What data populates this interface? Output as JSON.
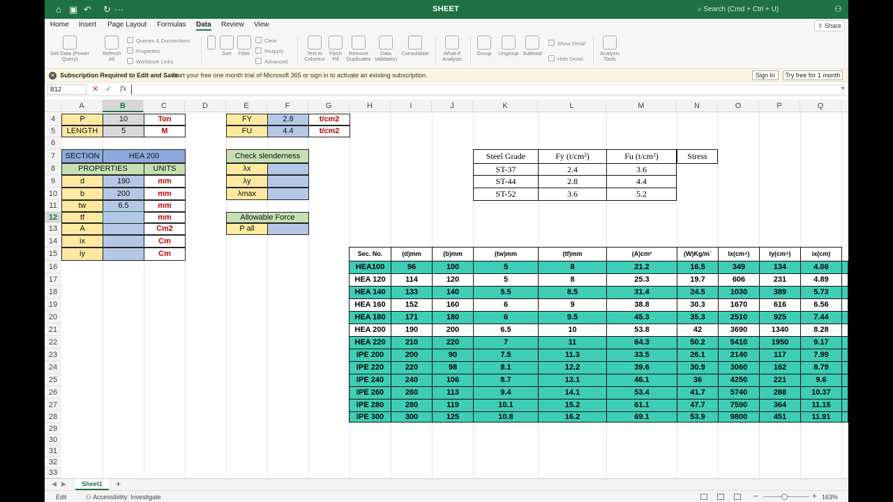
{
  "titlebar": {
    "title": "SHEET",
    "search_placeholder": "Search (Cmd + Ctrl + U)"
  },
  "tabs": [
    "Home",
    "Insert",
    "Page Layout",
    "Formulas",
    "Data",
    "Review",
    "View"
  ],
  "active_tab": "Data",
  "share_label": "Share",
  "ribbon": {
    "get_data": "Get Data (Power Query)",
    "refresh": "Refresh All",
    "queries": "Queries & Connections",
    "properties": "Properties",
    "workbook_links": "Workbook Links",
    "sort": "Sort",
    "filter": "Filter",
    "clear": "Clear",
    "reapply": "Reapply",
    "advanced": "Advanced",
    "text_to_columns": "Text to Columns",
    "flash_fill": "Flash Fill",
    "remove_duplicates": "Remove Duplicates",
    "data_validation": "Data Validation",
    "consolidate": "Consolidate",
    "what_if": "What-If Analysis",
    "group": "Group",
    "ungroup": "Ungroup",
    "subtotal": "Subtotal",
    "show_detail": "Show Detail",
    "hide_detail": "Hide Detail",
    "analysis_tools": "Analysis Tools"
  },
  "message_bar": {
    "heading": "Subscription Required to Edit and Save",
    "text": "Start your free one month trial of Microsoft 365 or sign in to activate an existing subscription.",
    "sign_in": "Sign In",
    "try_free": "Try free for 1 month"
  },
  "formula_bar": {
    "name_box": "B12",
    "fx": "fx",
    "value": ""
  },
  "columns": [
    "A",
    "B",
    "C",
    "D",
    "E",
    "F",
    "G",
    "H",
    "I",
    "J",
    "K",
    "L",
    "M",
    "N",
    "O",
    "P",
    "Q"
  ],
  "selected_column": "B",
  "rows": [
    "4",
    "5",
    "6",
    "7",
    "8",
    "9",
    "10",
    "11",
    "12",
    "13",
    "14",
    "15",
    "16",
    "17",
    "18",
    "19",
    "20",
    "21",
    "22",
    "23",
    "24",
    "25",
    "26",
    "27",
    "28",
    "29",
    "30",
    "31",
    "32",
    "33"
  ],
  "selected_row": "12",
  "inputs": {
    "p_label": "P",
    "p_value": "10",
    "p_unit": "Ton",
    "len_label": "LENGTH",
    "len_value": "5",
    "len_unit": "M",
    "fy_label": "FY",
    "fy_value": "2.8",
    "fy_unit": "t/cm2",
    "fu_label": "FU",
    "fu_value": "4.4",
    "fu_unit": "t/cm2"
  },
  "section": {
    "label": "SECTION",
    "value": "HEA 200",
    "properties_header": "PROPERTIES",
    "units_header": "UNITS",
    "props": [
      {
        "name": "d",
        "value": "190",
        "unit": "mm"
      },
      {
        "name": "b",
        "value": "200",
        "unit": "mm"
      },
      {
        "name": "tw",
        "value": "6.5",
        "unit": "mm"
      },
      {
        "name": "tf",
        "value": "",
        "unit": "mm"
      },
      {
        "name": "A",
        "value": "",
        "unit": "Cm2"
      },
      {
        "name": "ix",
        "value": "",
        "unit": "Cm"
      },
      {
        "name": "iy",
        "value": "",
        "unit": "Cm"
      }
    ]
  },
  "slenderness": {
    "header": "Check slenderness",
    "rows": [
      {
        "name": "λx",
        "value": ""
      },
      {
        "name": "λy",
        "value": ""
      },
      {
        "name": "λmax",
        "value": ""
      }
    ]
  },
  "allowable": {
    "header": "Allowable Force",
    "label": "P all",
    "value": ""
  },
  "steel_grades": {
    "headers": [
      "Steel Grade",
      "Fy (t/cm²)",
      "Fu (t/cm²)",
      "Stress"
    ],
    "rows": [
      [
        "ST-37",
        "2.4",
        "3.6"
      ],
      [
        "ST-44",
        "2.8",
        "4.4"
      ],
      [
        "ST-52",
        "3.6",
        "5.2"
      ]
    ]
  },
  "sections_table": {
    "headers": [
      "Sec. No.",
      "(d)mm",
      "(b)mm",
      "(tw)mm",
      "(tf)mm",
      "(A)cm²",
      "(W)Kg/m`",
      "Ix(cm⁴)",
      "Iy(cm⁴)",
      "ix(cm)"
    ],
    "rows": [
      [
        "HEA100",
        "96",
        "100",
        "5",
        "8",
        "21.2",
        "16.5",
        "349",
        "134",
        "4.06"
      ],
      [
        "HEA 120",
        "114",
        "120",
        "5",
        "8",
        "25.3",
        "19.7",
        "606",
        "231",
        "4.89"
      ],
      [
        "HEA 140",
        "133",
        "140",
        "5.5",
        "8.5",
        "31.4",
        "24.5",
        "1030",
        "389",
        "5.73"
      ],
      [
        "HEA 160",
        "152",
        "160",
        "6",
        "9",
        "38.8",
        "30.3",
        "1670",
        "616",
        "6.56"
      ],
      [
        "HEA 180",
        "171",
        "180",
        "6",
        "9.5",
        "45.3",
        "35.3",
        "2510",
        "925",
        "7.44"
      ],
      [
        "HEA 200",
        "190",
        "200",
        "6.5",
        "10",
        "53.8",
        "42",
        "3690",
        "1340",
        "8.28"
      ],
      [
        "HEA 220",
        "210",
        "220",
        "7",
        "11",
        "64.3",
        "50.2",
        "5410",
        "1950",
        "9.17"
      ],
      [
        "IPE 200",
        "200",
        "90",
        "7.5",
        "11.3",
        "33.5",
        "26.1",
        "2140",
        "117",
        "7.99"
      ],
      [
        "IPE 220",
        "220",
        "98",
        "8.1",
        "12.2",
        "39.6",
        "30.9",
        "3060",
        "162",
        "8.79"
      ],
      [
        "IPE 240",
        "240",
        "106",
        "8.7",
        "13.1",
        "46.1",
        "36",
        "4250",
        "221",
        "9.6"
      ],
      [
        "IPE 260",
        "260",
        "113",
        "9.4",
        "14.1",
        "53.4",
        "41.7",
        "5740",
        "288",
        "10.37"
      ],
      [
        "IPE 280",
        "280",
        "119",
        "10.1",
        "15.2",
        "61.1",
        "47.7",
        "7590",
        "364",
        "11.15"
      ],
      [
        "IPE 300",
        "300",
        "125",
        "10.8",
        "16.2",
        "69.1",
        "53.9",
        "9800",
        "451",
        "11.91"
      ]
    ]
  },
  "sheet_tab": "Sheet1",
  "status": {
    "mode": "Edit",
    "accessibility": "Accessibility: Investigate",
    "zoom": "163%"
  },
  "colors": {
    "excel_green": "#1e7145",
    "teal_row": "#3ecdb6"
  }
}
